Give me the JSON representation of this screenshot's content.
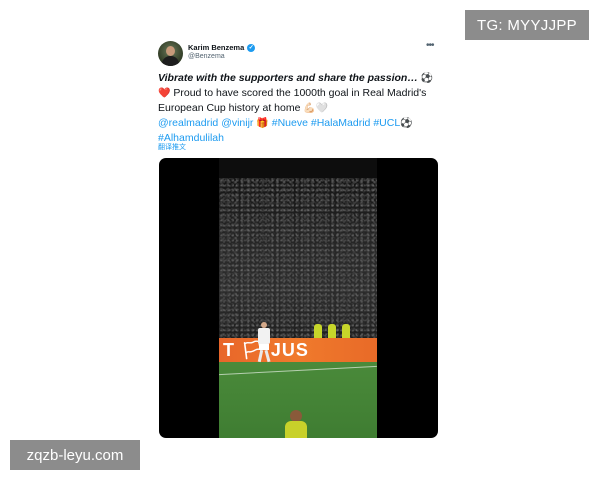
{
  "overlay": {
    "tg_badge": "TG: MYYJJPP",
    "watermark": "zqzb-leyu.com"
  },
  "tweet": {
    "author_name": "Karim Benzema",
    "author_handle": "@Benzema",
    "more_icon": "more-dots-icon",
    "lead_text": "Vibrate with the supporters and share the passion…",
    "emoji_ball": "⚽",
    "emoji_heart": "❤️",
    "body_text": " Proud to have scored the 1000th goal in Real Madrid's European Cup history at home ",
    "emoji_flex": "💪🏻",
    "emoji_white_heart": "🤍",
    "mention_1": "@realmadrid",
    "mention_2": "@vinijr",
    "emoji_gift": "🎁",
    "hashtag_1": "#Nueve",
    "hashtag_2": "#HalaMadrid",
    "hashtag_3": "#UCL",
    "emoji_ball_2": "⚽",
    "hashtag_4": "#Alhamdulilah",
    "translate_label": "翻译推文"
  },
  "media": {
    "ad_board_text": "T  🏳 JUS"
  },
  "colors": {
    "link": "#1d9bf0",
    "verified": "#1d9bf0",
    "overlay_bg": "#8c8c8c"
  }
}
